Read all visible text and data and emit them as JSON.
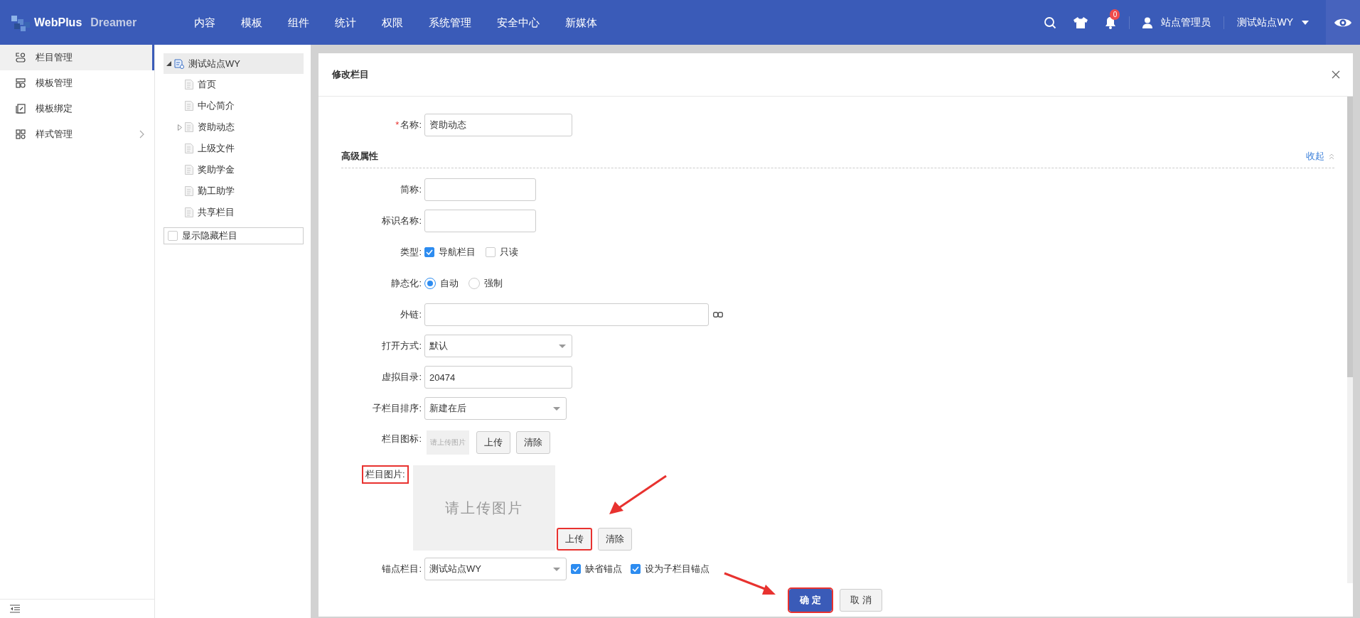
{
  "header": {
    "logo_main": "WebPlus",
    "logo_sub": "Dreamer",
    "nav": [
      {
        "label": "内容"
      },
      {
        "label": "模板"
      },
      {
        "label": "组件"
      },
      {
        "label": "统计"
      },
      {
        "label": "权限"
      },
      {
        "label": "系统管理"
      },
      {
        "label": "安全中心"
      },
      {
        "label": "新媒体"
      }
    ],
    "notification_count": "0",
    "user": "站点管理员",
    "site": "测试站点WY"
  },
  "sidebar": {
    "items": [
      {
        "label": "栏目管理",
        "selected": true,
        "has_submenu": false
      },
      {
        "label": "模板管理",
        "selected": false,
        "has_submenu": false
      },
      {
        "label": "模板绑定",
        "selected": false,
        "has_submenu": false
      },
      {
        "label": "样式管理",
        "selected": false,
        "has_submenu": true
      }
    ]
  },
  "tree": {
    "root": {
      "label": "测试站点WY",
      "expanded": true,
      "selected": true,
      "children": [
        {
          "label": "首页",
          "has_children": false
        },
        {
          "label": "中心简介",
          "has_children": false
        },
        {
          "label": "资助动态",
          "has_children": true
        },
        {
          "label": "上级文件",
          "has_children": false
        },
        {
          "label": "奖助学金",
          "has_children": false
        },
        {
          "label": "勤工助学",
          "has_children": false
        },
        {
          "label": "共享栏目",
          "has_children": false
        }
      ]
    },
    "show_hidden": {
      "label": "显示隐藏栏目",
      "checked": false
    }
  },
  "dialog": {
    "title": "修改栏目",
    "name_field": {
      "label": "名称:",
      "required_mark": "*",
      "value": "资助动态"
    },
    "section": {
      "title": "高级属性",
      "toggle": "收起"
    },
    "fields": [
      {
        "kind": "text",
        "label": "简称:"
      },
      {
        "kind": "text",
        "label": "标识名称:"
      },
      {
        "kind": "checkboxes",
        "label": "类型:",
        "options": [
          {
            "label": "导航栏目",
            "checked": true
          },
          {
            "label": "只读",
            "checked": false
          }
        ]
      },
      {
        "kind": "radios",
        "label": "静态化:",
        "options": [
          {
            "label": "自动",
            "selected": true
          },
          {
            "label": "强制",
            "selected": false
          }
        ]
      },
      {
        "kind": "link",
        "label": "外链:"
      },
      {
        "kind": "select",
        "label": "打开方式:",
        "value": "默认"
      },
      {
        "kind": "text",
        "label": "虚拟目录:",
        "value": "20474"
      },
      {
        "kind": "select",
        "label": "子栏目排序:",
        "value": "新建在后"
      },
      {
        "kind": "image_small",
        "label": "栏目图标:",
        "placeholder": "请上传图片",
        "buttons": [
          {
            "label": "上传",
            "highlighted": false
          },
          {
            "label": "清除",
            "highlighted": false
          }
        ]
      },
      {
        "kind": "image_large",
        "label": "栏目图片:",
        "label_highlighted": true,
        "placeholder": "请上传图片",
        "buttons": [
          {
            "label": "上传",
            "highlighted": true
          },
          {
            "label": "清除",
            "highlighted": false
          }
        ]
      },
      {
        "kind": "anchor",
        "label": "锚点栏目:",
        "value": "测试站点WY",
        "options": [
          {
            "label": "缺省锚点",
            "checked": true
          },
          {
            "label": "设为子栏目锚点",
            "checked": true
          }
        ]
      }
    ],
    "buttons": [
      {
        "label": "确 定",
        "primary": true,
        "highlighted": true
      },
      {
        "label": "取 消",
        "primary": false,
        "highlighted": false
      }
    ]
  }
}
